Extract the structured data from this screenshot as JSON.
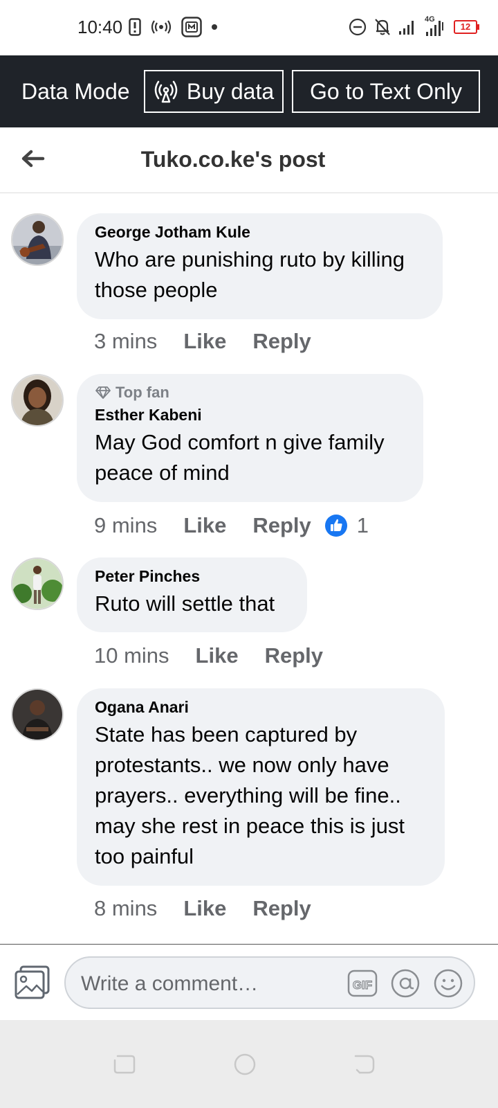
{
  "status_bar": {
    "time": "10:40",
    "network": "4G",
    "battery": "12"
  },
  "data_mode_bar": {
    "label": "Data Mode",
    "buy_data": "Buy data",
    "text_only": "Go to Text Only"
  },
  "header": {
    "title": "Tuko.co.ke's post"
  },
  "comments": [
    {
      "author": "George Jotham Kule",
      "text": "Who are punishing ruto by killing those people",
      "time": "3 mins",
      "like": "Like",
      "reply": "Reply"
    },
    {
      "badge": "Top fan",
      "author": "Esther Kabeni",
      "text": "May God comfort n give family peace of mind",
      "time": "9 mins",
      "like": "Like",
      "reply": "Reply",
      "reaction_count": "1"
    },
    {
      "author": "Peter Pinches",
      "text": "Ruto will settle that",
      "time": "10 mins",
      "like": "Like",
      "reply": "Reply"
    },
    {
      "author": "Ogana Anari",
      "text": "State has been captured by protestants.. we now only have prayers.. everything will be fine.. may she rest in peace this is just too painful",
      "time": "8 mins",
      "like": "Like",
      "reply": "Reply"
    }
  ],
  "composer": {
    "placeholder": "Write a comment…",
    "gif": "GIF"
  },
  "colors": {
    "data_bar_bg": "#1f2329",
    "bubble_bg": "#f0f2f5",
    "meta_text": "#65676b",
    "like_blue": "#1877f2",
    "battery_red": "#e02020"
  }
}
